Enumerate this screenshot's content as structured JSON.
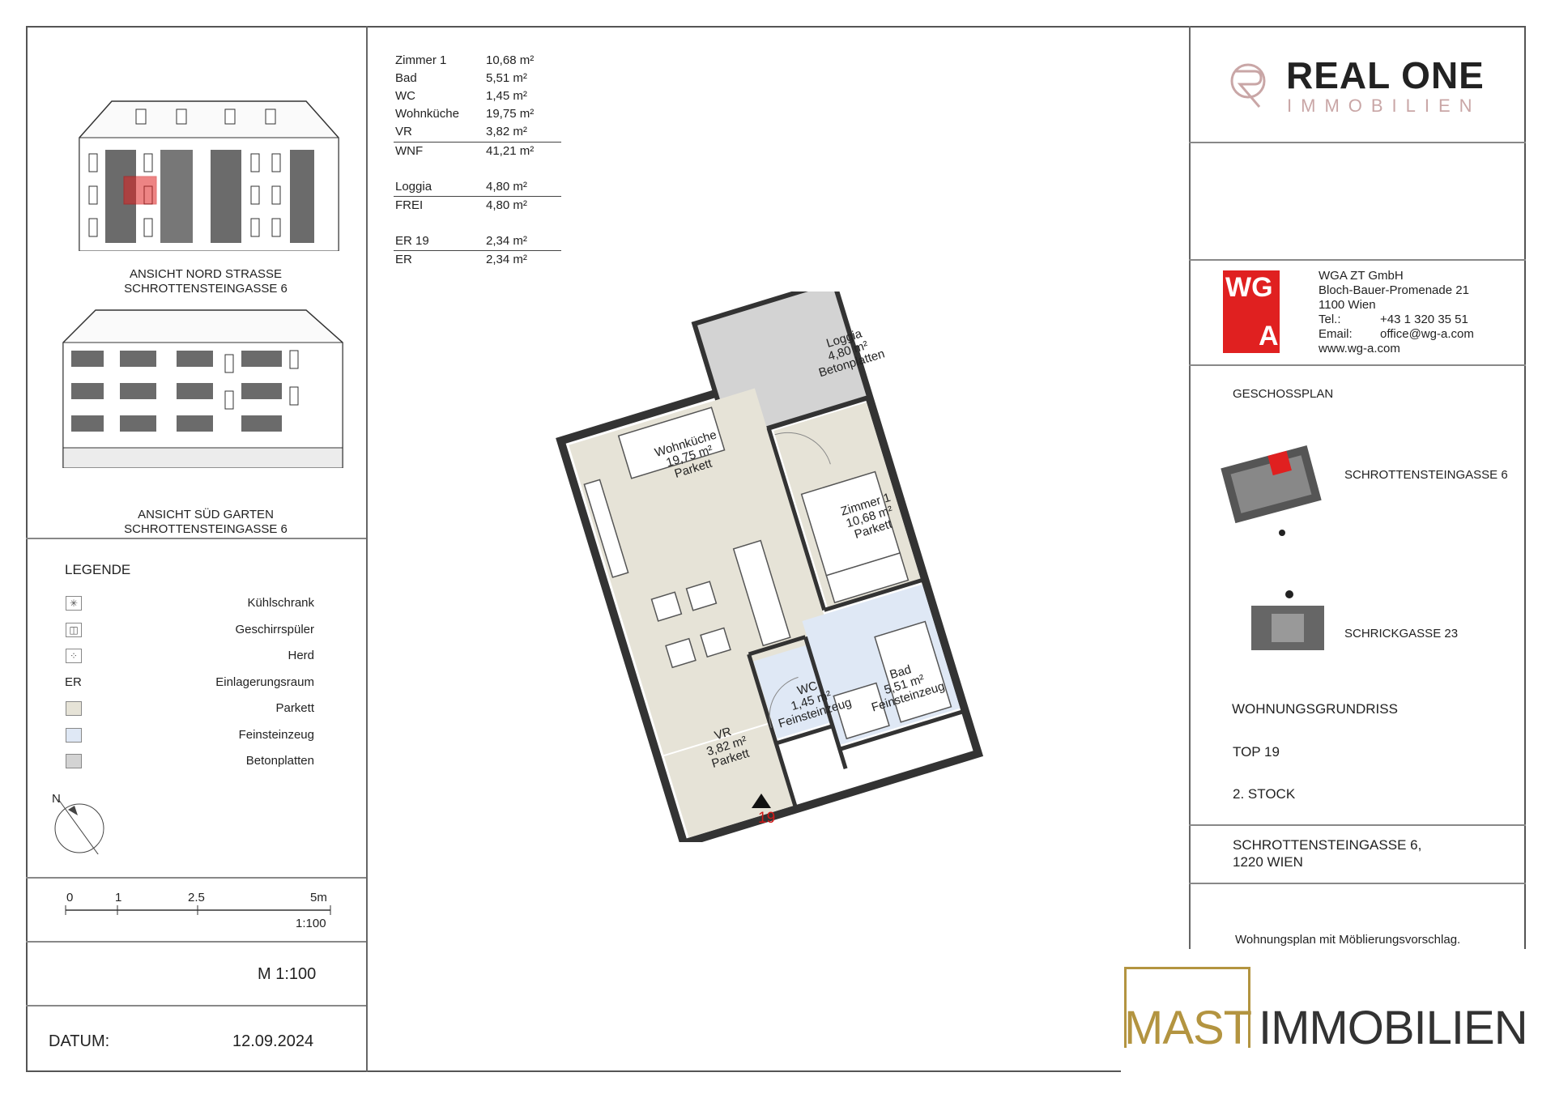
{
  "areas": {
    "rows1": [
      {
        "k": "Zimmer 1",
        "v": "10,68 m²"
      },
      {
        "k": "Bad",
        "v": "5,51 m²"
      },
      {
        "k": "WC",
        "v": "1,45 m²"
      },
      {
        "k": "Wohnküche",
        "v": "19,75 m²"
      },
      {
        "k": "VR",
        "v": "3,82 m²"
      }
    ],
    "wnf": {
      "k": "WNF",
      "v": "41,21 m²"
    },
    "loggia": {
      "k": "Loggia",
      "v": "4,80 m²"
    },
    "frei": {
      "k": "FREI",
      "v": "4,80 m²"
    },
    "er19": {
      "k": "ER 19",
      "v": "2,34 m²"
    },
    "er": {
      "k": "ER",
      "v": "2,34 m²"
    }
  },
  "elevations": {
    "north": {
      "line1": "ANSICHT NORD STRASSE",
      "line2": "SCHROTTENSTEINGASSE 6"
    },
    "south": {
      "line1": "ANSICHT SÜD GARTEN",
      "line2": "SCHROTTENSTEINGASSE 6"
    }
  },
  "legend": {
    "title": "LEGENDE",
    "items": [
      {
        "sym": "✳",
        "label": "Kühlschrank"
      },
      {
        "sym": "◫",
        "label": "Geschirrspüler"
      },
      {
        "sym": "⁘",
        "label": "Herd"
      },
      {
        "sym": "ER",
        "label": "Einlagerungsraum"
      },
      {
        "sym": "",
        "label": "Parkett",
        "color": "#e6e3d7"
      },
      {
        "sym": "",
        "label": "Feinsteinzeug",
        "color": "#dfe8f5"
      },
      {
        "sym": "",
        "label": "Betonplatten",
        "color": "#d3d3d3"
      }
    ]
  },
  "north_label": "N",
  "scale_bar": {
    "t0": "0",
    "t1": "1",
    "t2": "2.5",
    "t3": "5m",
    "ratio": "1:100"
  },
  "scale": "M 1:100",
  "date": {
    "label": "DATUM:",
    "value": "12.09.2024"
  },
  "plan": {
    "loggia": {
      "name": "Loggia",
      "area": "4,80 m²",
      "floor": "Betonplatten"
    },
    "kitchen": {
      "name": "Wohnküche",
      "area": "19,75 m²",
      "floor": "Parkett"
    },
    "room1": {
      "name": "Zimmer 1",
      "area": "10,68 m²",
      "floor": "Parkett"
    },
    "bath": {
      "name": "Bad",
      "area": "5,51 m²",
      "floor": "Feinsteinzeug"
    },
    "wc": {
      "name": "WC",
      "area": "1,45 m²",
      "floor": "Feinsteinzeug"
    },
    "vr": {
      "name": "VR",
      "area": "3,82 m²",
      "floor": "Parkett"
    },
    "entrance_no": "19"
  },
  "brand": {
    "real": "REAL ONE",
    "immo": "IMMOBILIEN"
  },
  "wga": {
    "logo_top": "WG",
    "logo_bottom": "A",
    "name": "WGA ZT GmbH",
    "street": "Bloch-Bauer-Promenade 21",
    "city": "1100 Wien",
    "tel_label": "Tel.:",
    "tel": "+43 1 320 35 51",
    "email_label": "Email:",
    "email": "office@wg-a.com",
    "web": "www.wg-a.com"
  },
  "geschossplan": {
    "title": "GESCHOSSPLAN",
    "b1": "SCHROTTENSTEINGASSE 6",
    "b2": "SCHRICKGASSE 23"
  },
  "info": {
    "title": "WOHNUNGSGRUNDRISS",
    "top": "TOP 19",
    "floor": "2. STOCK",
    "addr1": "SCHROTTENSTEINGASSE 6,",
    "addr2": "1220 WIEN",
    "note": "Wohnungsplan mit Möblierungsvorschlag."
  },
  "mast": {
    "a": "MAST",
    "b": "IMMOBILIEN"
  },
  "colors": {
    "parkett": "#e6e3d7",
    "fliese": "#dfe8f5",
    "beton": "#d3d3d3",
    "red": "#e02020",
    "gold": "#b39440",
    "rose": "#c9a6a6"
  }
}
